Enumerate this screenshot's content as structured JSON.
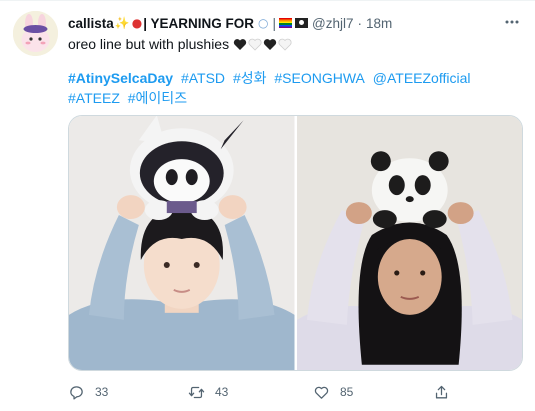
{
  "author": {
    "display_name": "callista",
    "name_suffix": "| YEARNING FOR",
    "handle": "@zhjl7",
    "separator": "·",
    "time": "18m"
  },
  "text": "oreo line but with plushies",
  "hashtags": [
    "#AtinySelcaDay",
    "#ATSD",
    "#성화",
    "#SEONGHWA",
    "@ATEEZofficial",
    "#ATEEZ",
    "#에이티즈"
  ],
  "stats": {
    "replies": "33",
    "retweets": "43",
    "likes": "85"
  },
  "icons": {
    "more": "more-icon",
    "reply": "reply-icon",
    "retweet": "retweet-icon",
    "like": "like-icon",
    "share": "share-icon"
  },
  "colors": {
    "link": "#1d9bf0",
    "meta": "#536471",
    "text": "#0f1419"
  }
}
